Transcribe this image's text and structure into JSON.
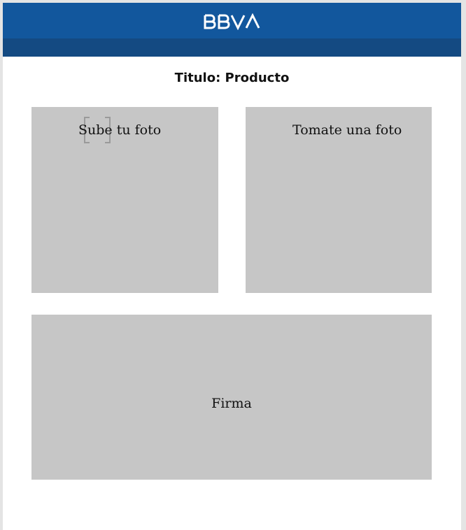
{
  "header": {
    "brand_name": "BBVA",
    "icon": "bbva-logo",
    "background_color": "#12579d",
    "subbar_color": "#144a82"
  },
  "page": {
    "title": "Titulo: Producto"
  },
  "cards": {
    "upload_photo": {
      "label": "Sube tu foto",
      "icon": "scan-frame-icon"
    },
    "take_photo": {
      "label": "Tomate una foto"
    },
    "signature": {
      "label": "Firma"
    },
    "card_color": "#c6c6c6"
  }
}
